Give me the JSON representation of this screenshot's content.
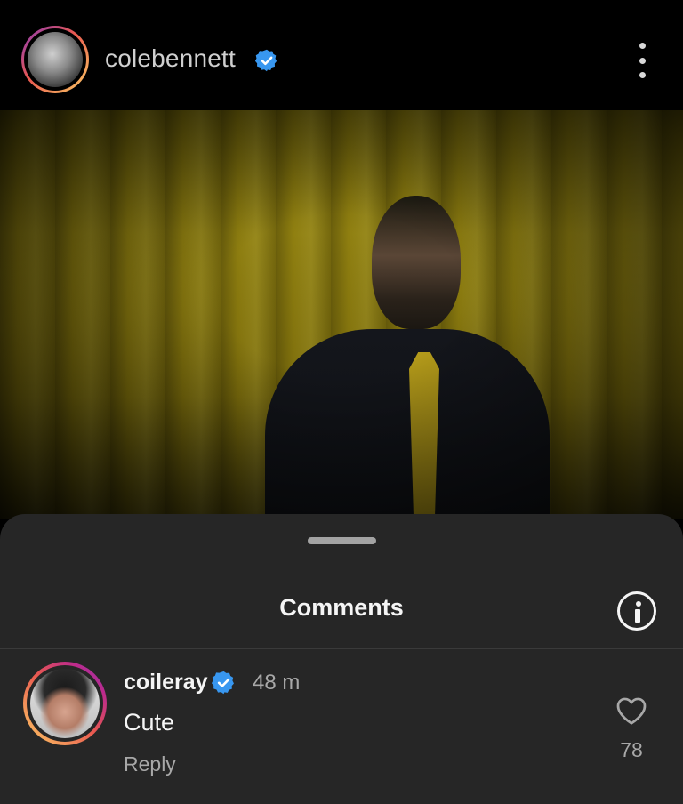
{
  "header": {
    "username": "colebennett",
    "verified": true
  },
  "sheet": {
    "title": "Comments"
  },
  "comment": {
    "username": "coileray",
    "verified": true,
    "time": "48 m",
    "text": "Cute",
    "reply_label": "Reply",
    "like_count": "78"
  },
  "colors": {
    "verified_blue": "#3897f0",
    "sheet_bg": "#262626",
    "muted_text": "#a8a8a8"
  },
  "icons": [
    "verified-icon",
    "more-options-icon",
    "info-icon",
    "heart-icon"
  ]
}
